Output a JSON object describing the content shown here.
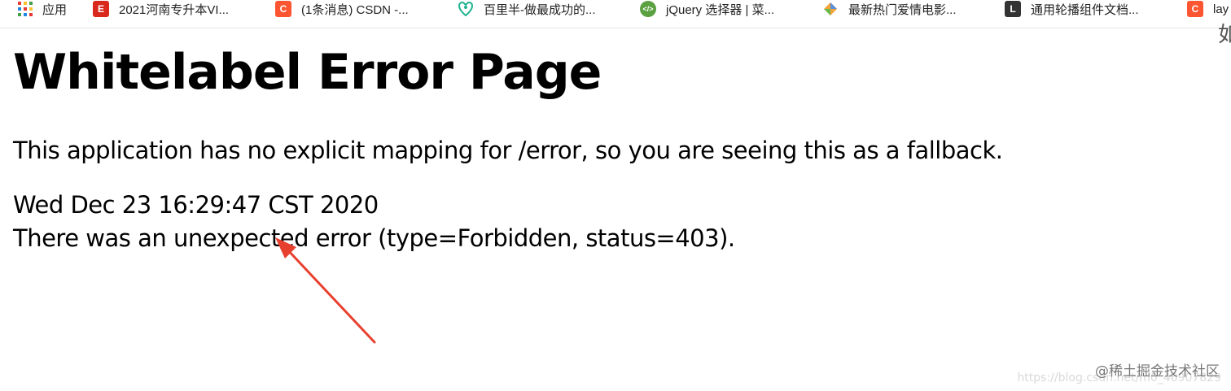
{
  "bookmarks": [
    {
      "label": "应用",
      "icon": "apps-grid-icon"
    },
    {
      "label": "2021河南专升本VI...",
      "icon": "zsb-logo-icon"
    },
    {
      "label": "(1条消息) CSDN -...",
      "icon": "csdn-icon"
    },
    {
      "label": "百里半-做最成功的...",
      "icon": "baili-icon"
    },
    {
      "label": "jQuery 选择器 | 菜...",
      "icon": "runoob-icon"
    },
    {
      "label": "最新热门爱情电影...",
      "icon": "movie-icon"
    },
    {
      "label": "通用轮播组件文档...",
      "icon": "doc-icon"
    },
    {
      "label": "lay",
      "icon": "csdn-icon"
    }
  ],
  "edge_glyph": "如",
  "page": {
    "title": "Whitelabel Error Page",
    "description": "This application has no explicit mapping for /error, so you are seeing this as a fallback.",
    "timestamp": "Wed Dec 23 16:29:47 CST 2020",
    "error_message": "There was an unexpected error (type=Forbidden, status=403)."
  },
  "watermark": {
    "text": "@稀土掘金技术社区",
    "faint_text": "https://blog.csdn.net/m0_46907829"
  },
  "colors": {
    "arrow": "#e8402f",
    "csdn": "#fc5531"
  }
}
